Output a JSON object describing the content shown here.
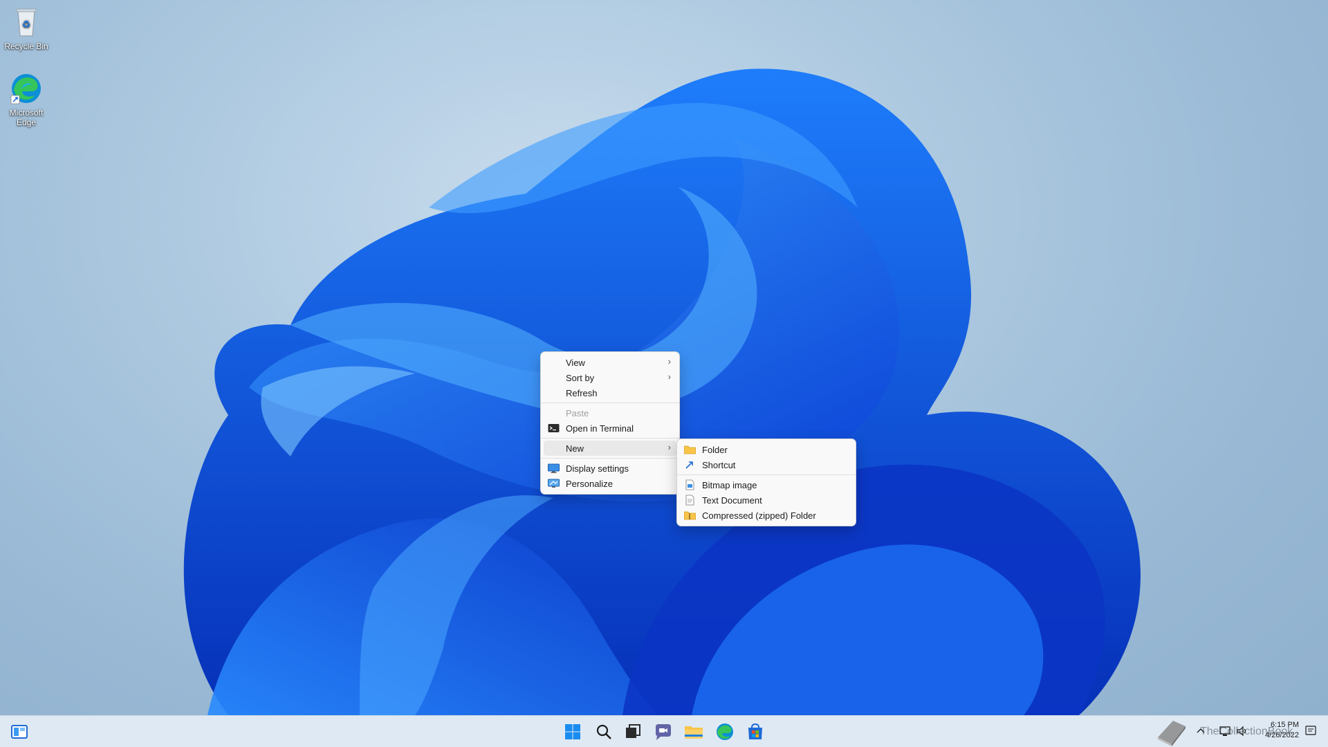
{
  "desktop": {
    "icons": [
      {
        "label": "Recycle Bin",
        "icon": "recycle-bin-icon"
      },
      {
        "label": "Microsoft Edge",
        "icon": "edge-icon"
      }
    ]
  },
  "context_menu": {
    "items": [
      {
        "label": "View",
        "has_submenu": true
      },
      {
        "label": "Sort by",
        "has_submenu": true
      },
      {
        "label": "Refresh"
      },
      {
        "label": "Paste",
        "disabled": true
      },
      {
        "label": "Open in Terminal",
        "icon": "terminal-icon"
      },
      {
        "label": "New",
        "has_submenu": true,
        "active": true
      },
      {
        "label": "Display settings",
        "icon": "display-icon"
      },
      {
        "label": "Personalize",
        "icon": "personalize-icon"
      }
    ],
    "arrow": "›"
  },
  "new_submenu": {
    "items": [
      {
        "label": "Folder",
        "icon": "folder-icon"
      },
      {
        "label": "Shortcut",
        "icon": "shortcut-icon"
      },
      {
        "label": "Bitmap image",
        "icon": "bitmap-icon"
      },
      {
        "label": "Text Document",
        "icon": "text-document-icon"
      },
      {
        "label": "Compressed (zipped) Folder",
        "icon": "zip-folder-icon"
      }
    ]
  },
  "taskbar": {
    "apps": [
      "start-icon",
      "search-icon",
      "task-view-icon",
      "teams-chat-icon",
      "file-explorer-icon",
      "edge-icon",
      "store-icon"
    ],
    "tray": {
      "time": "6:15 PM",
      "date": "4/26/2022",
      "watermark": "TheCollectionBook"
    }
  },
  "colors": {
    "accent": "#0067c0",
    "menu_bg": "#f9f9f9",
    "taskbar_bg": "#dfe9f3"
  }
}
